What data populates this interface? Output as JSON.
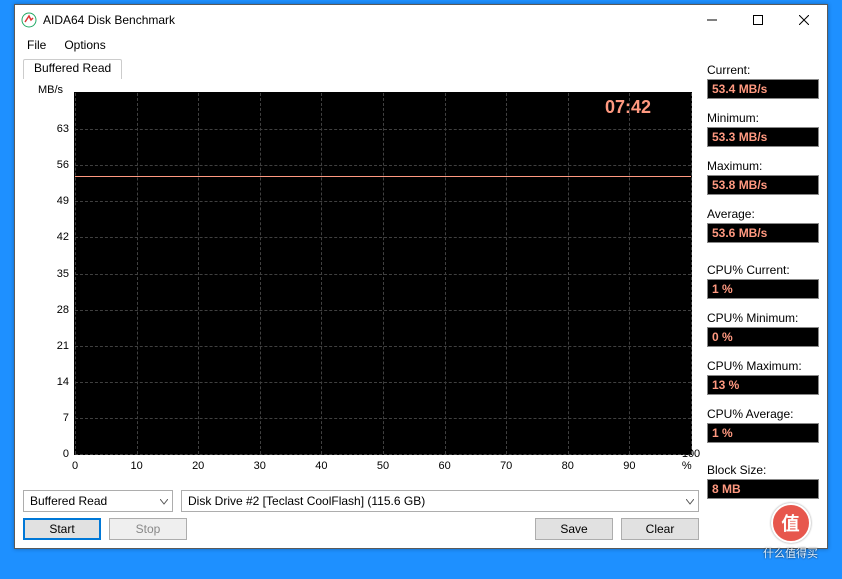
{
  "window": {
    "title": "AIDA64 Disk Benchmark"
  },
  "menu": {
    "file": "File",
    "options": "Options"
  },
  "tab": {
    "buffered_read": "Buffered Read"
  },
  "chart_data": {
    "type": "line",
    "title": "",
    "xlabel": "",
    "ylabel": "MB/s",
    "xlim": [
      0,
      100
    ],
    "ylim": [
      0,
      70
    ],
    "x_ticks": [
      0,
      10,
      20,
      30,
      40,
      50,
      60,
      70,
      80,
      90,
      100
    ],
    "x_tick_suffix_last": "%",
    "y_ticks": [
      0,
      7,
      14,
      21,
      28,
      35,
      42,
      49,
      56,
      63
    ],
    "categories": [
      0,
      10,
      20,
      30,
      40,
      50,
      60,
      70,
      80,
      90,
      100
    ],
    "series": [
      {
        "name": "Buffered Read",
        "values": [
          54,
          54,
          54,
          54,
          54,
          54,
          54,
          54,
          54,
          54,
          54
        ]
      }
    ],
    "elapsed_time": "07:42"
  },
  "controls": {
    "test_select": "Buffered Read",
    "drive_select": "Disk Drive #2  [Teclast CoolFlash]  (115.6 GB)",
    "start": "Start",
    "stop": "Stop",
    "save": "Save",
    "clear": "Clear"
  },
  "stats": {
    "current_label": "Current:",
    "current_value": "53.4 MB/s",
    "min_label": "Minimum:",
    "min_value": "53.3 MB/s",
    "max_label": "Maximum:",
    "max_value": "53.8 MB/s",
    "avg_label": "Average:",
    "avg_value": "53.6 MB/s",
    "cpu_cur_label": "CPU% Current:",
    "cpu_cur_value": "1 %",
    "cpu_min_label": "CPU% Minimum:",
    "cpu_min_value": "0 %",
    "cpu_max_label": "CPU% Maximum:",
    "cpu_max_value": "13 %",
    "cpu_avg_label": "CPU% Average:",
    "cpu_avg_value": "1 %",
    "block_label": "Block Size:",
    "block_value": "8 MB"
  },
  "watermark": {
    "symbol": "值",
    "text": "什么值得买"
  }
}
